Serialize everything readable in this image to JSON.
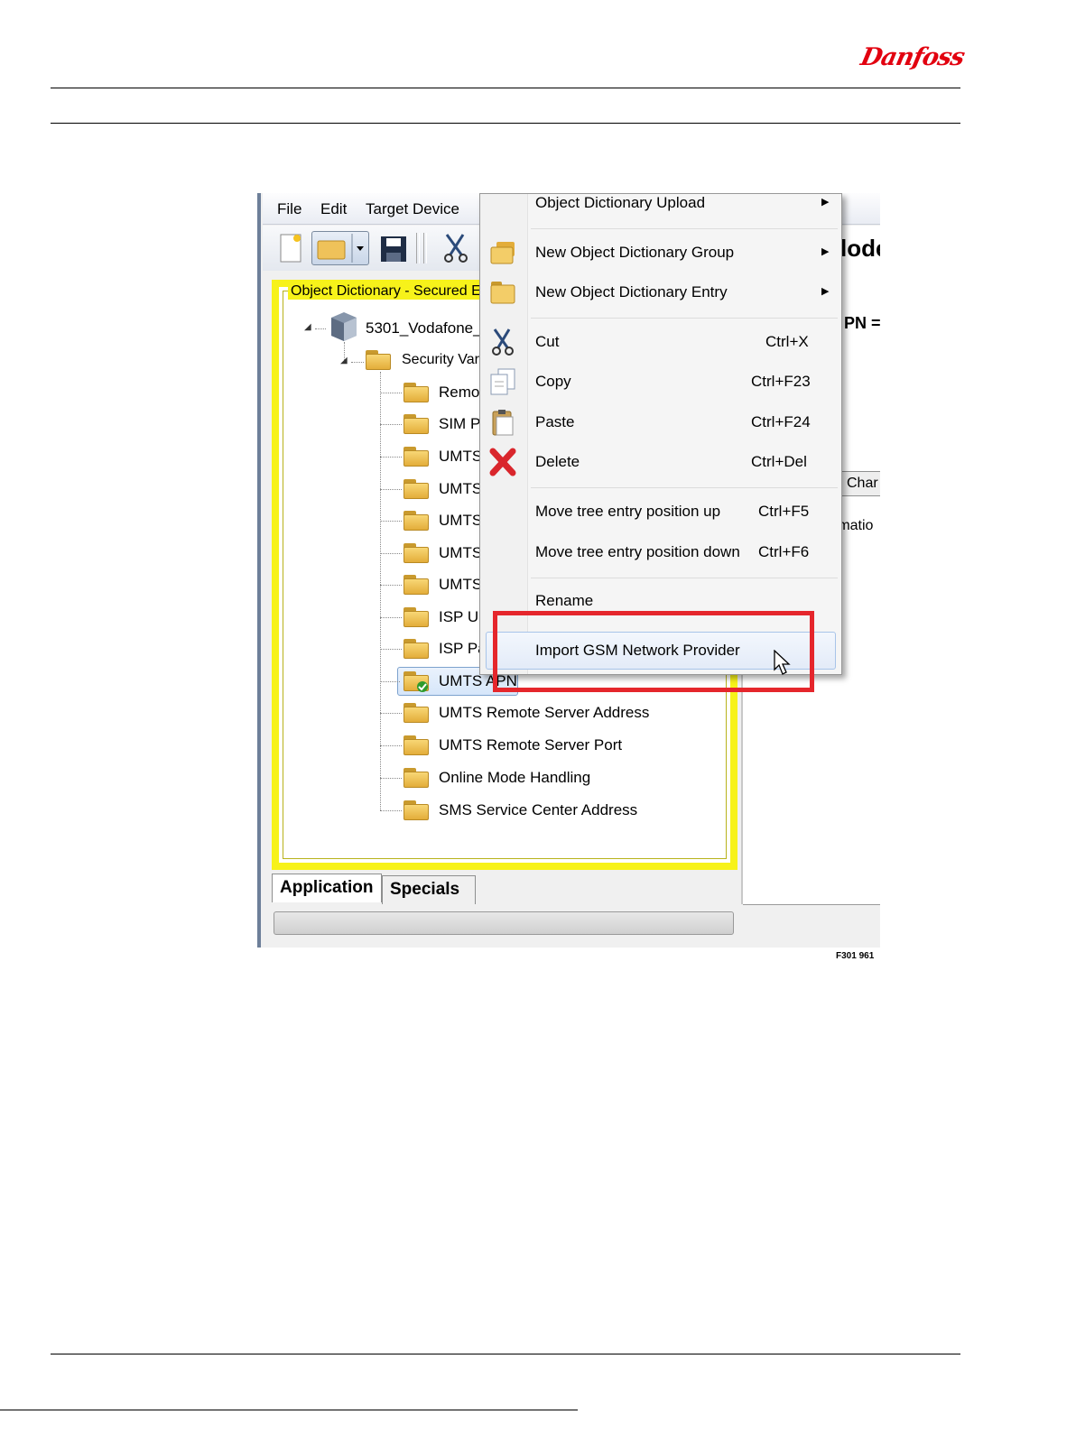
{
  "header": {
    "logo_text": "Danfoss"
  },
  "app": {
    "menu": [
      "File",
      "Edit",
      "Target Device"
    ],
    "right_panel": {
      "title_fragment": "lode",
      "label_fragment": "PN =",
      "button1": "Char",
      "button2": "rmatio"
    }
  },
  "tree": {
    "panel_title": "Object Dictionary - Secured E",
    "root": "5301_Vodafone_I",
    "group": "Security Var",
    "items": [
      "Remot",
      "SIM P",
      "UMTS",
      "UMTS",
      "UMTS",
      "UMTS",
      "UMTS",
      "ISP U:",
      "ISP Pa",
      "UMTS APN",
      "UMTS Remote Server Address",
      "UMTS Remote Server Port",
      "Online Mode Handling",
      "SMS Service Center Address"
    ],
    "selected_index": 9
  },
  "tabs": [
    "Application",
    "Specials"
  ],
  "context_menu": {
    "items": [
      {
        "label": "Object Dictionary Upload",
        "shortcut": "",
        "submenu": true
      },
      {
        "label": "New Object Dictionary Group",
        "shortcut": "",
        "submenu": true
      },
      {
        "label": "New Object Dictionary Entry",
        "shortcut": "",
        "submenu": true
      },
      {
        "label": "Cut",
        "shortcut": "Ctrl+X"
      },
      {
        "label": "Copy",
        "shortcut": "Ctrl+F23"
      },
      {
        "label": "Paste",
        "shortcut": "Ctrl+F24"
      },
      {
        "label": "Delete",
        "shortcut": "Ctrl+Del"
      },
      {
        "label": "Move tree entry position up",
        "shortcut": "Ctrl+F5"
      },
      {
        "label": "Move tree entry position down",
        "shortcut": "Ctrl+F6"
      },
      {
        "label": "Rename",
        "shortcut": ""
      },
      {
        "label": "Import GSM Network Provider",
        "shortcut": ""
      }
    ],
    "highlighted": "Import GSM Network Provider"
  },
  "figure_code": "F301 961",
  "colors": {
    "brand_red": "#e2000f",
    "panel_yellow": "#f7f21a",
    "highlight_red": "#e5262c"
  }
}
